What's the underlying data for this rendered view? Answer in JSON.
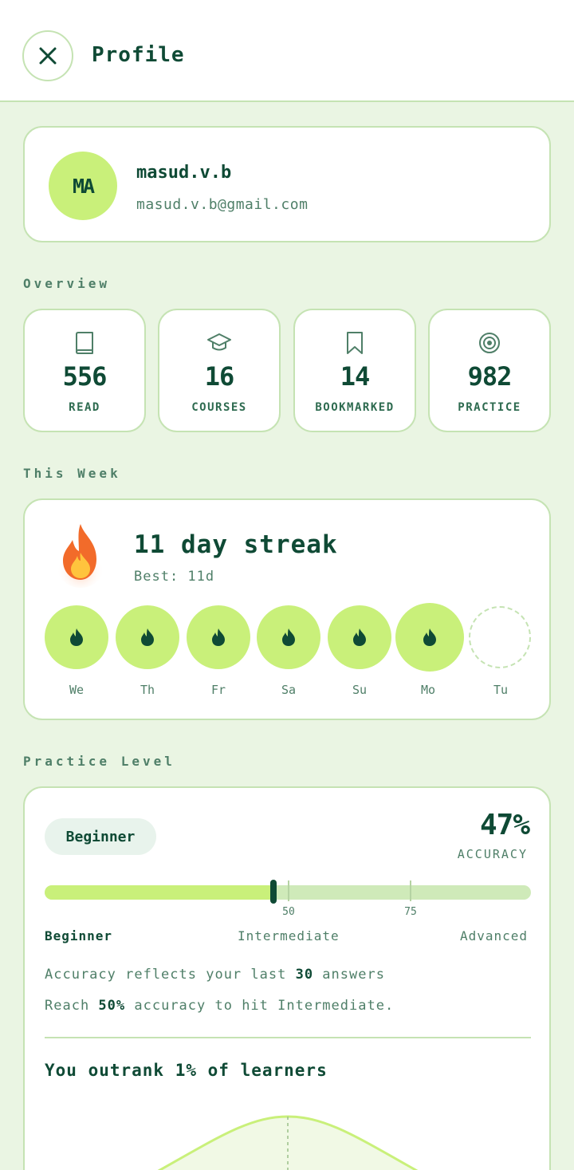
{
  "header": {
    "title": "Profile"
  },
  "profile": {
    "initials": "MA",
    "username": "masud.v.b",
    "email": "masud.v.b@gmail.com"
  },
  "overview": {
    "label": "Overview",
    "stats": [
      {
        "icon": "book-icon",
        "value": "556",
        "label": "READ"
      },
      {
        "icon": "graduation-cap-icon",
        "value": "16",
        "label": "COURSES"
      },
      {
        "icon": "bookmark-icon",
        "value": "14",
        "label": "BOOKMARKED"
      },
      {
        "icon": "target-icon",
        "value": "982",
        "label": "PRACTICE"
      }
    ]
  },
  "week": {
    "label": "This Week",
    "streak_title": "11 day streak",
    "best": "Best: 11d",
    "days": [
      {
        "label": "We",
        "done": true
      },
      {
        "label": "Th",
        "done": true
      },
      {
        "label": "Fr",
        "done": true
      },
      {
        "label": "Sa",
        "done": true
      },
      {
        "label": "Su",
        "done": true
      },
      {
        "label": "Mo",
        "done": true
      },
      {
        "label": "Tu",
        "done": false
      }
    ]
  },
  "practice": {
    "label": "Practice Level",
    "badge": "Beginner",
    "accuracy": "47%",
    "accuracy_label": "ACCURACY",
    "accuracy_value": 47,
    "ticks": [
      "50",
      "75"
    ],
    "levels": [
      "Beginner",
      "Intermediate",
      "Advanced"
    ],
    "note1_pre": "Accuracy reflects your last ",
    "note1_num": "30",
    "note1_post": " answers",
    "note2_pre": "Reach ",
    "note2_num": "50%",
    "note2_post": " accuracy to hit Intermediate.",
    "outrank": "You outrank 1% of learners"
  },
  "colors": {
    "accent": "#c9f07a",
    "primary": "#0f4a35",
    "background": "#eaf5e3",
    "border": "#c5e3b3"
  }
}
